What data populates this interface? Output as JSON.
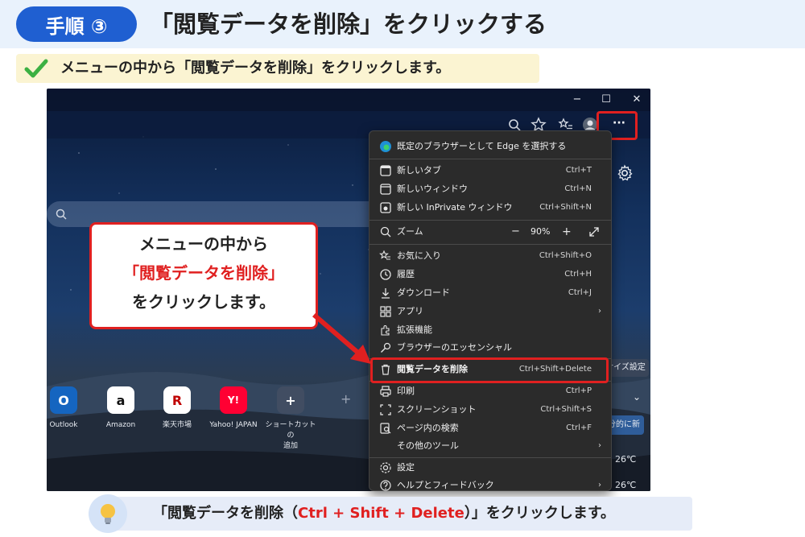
{
  "header": {
    "step_badge": "手順 ③",
    "title": "「閲覧データを削除」をクリックする"
  },
  "instruction": {
    "text": "メニューの中から「閲覧データを削除」をクリックします。"
  },
  "browser": {
    "window_controls": {
      "minimize": "−",
      "maximize": "☐",
      "close": "✕"
    },
    "more_button": "···",
    "shortcuts": [
      {
        "label": "Outlook",
        "glyph": "O"
      },
      {
        "label": "Amazon",
        "glyph": "a"
      },
      {
        "label": "楽天市場",
        "glyph": "R"
      },
      {
        "label": "Yahoo! JAPAN",
        "glyph": "Y!"
      },
      {
        "label": "ショートカットの\n追加",
        "glyph": "+"
      }
    ],
    "extra_plus": "+",
    "right_fragments": {
      "customize": "ナイズ設定",
      "news": "分的に新",
      "temp1": "26℃",
      "temp2": "26℃",
      "chevron": "⌄"
    }
  },
  "menu": {
    "default_browser": "既定のブラウザーとして Edge を選択する",
    "new_tab": "新しいタブ",
    "new_tab_sc": "Ctrl+T",
    "new_window": "新しいウィンドウ",
    "new_window_sc": "Ctrl+N",
    "new_private": "新しい InPrivate ウィンドウ",
    "new_private_sc": "Ctrl+Shift+N",
    "zoom": "ズーム",
    "zoom_minus": "−",
    "zoom_value": "90%",
    "zoom_plus": "+",
    "favorites": "お気に入り",
    "favorites_sc": "Ctrl+Shift+O",
    "history": "履歴",
    "history_sc": "Ctrl+H",
    "downloads": "ダウンロード",
    "downloads_sc": "Ctrl+J",
    "apps": "アプリ",
    "extensions": "拡張機能",
    "essentials": "ブラウザーのエッセンシャル",
    "clear_data": "閲覧データを削除",
    "clear_data_sc": "Ctrl+Shift+Delete",
    "print": "印刷",
    "print_sc": "Ctrl+P",
    "screenshot": "スクリーンショット",
    "screenshot_sc": "Ctrl+Shift+S",
    "find": "ページ内の検索",
    "find_sc": "Ctrl+F",
    "more_tools": "その他のツール",
    "settings": "設定",
    "help": "ヘルプとフィードバック",
    "arrow": "›"
  },
  "callout": {
    "line1": "メニューの中から",
    "line2": "「閲覧データを削除」",
    "line3": "をクリックします。"
  },
  "tip": {
    "before": "「閲覧データを削除（",
    "shortcut": "Ctrl + Shift + Delete",
    "after": "）」をクリックします。"
  },
  "colors": {
    "accent_blue": "#1f5fd1",
    "highlight_red": "#e02020",
    "check_green": "#3cb043"
  }
}
